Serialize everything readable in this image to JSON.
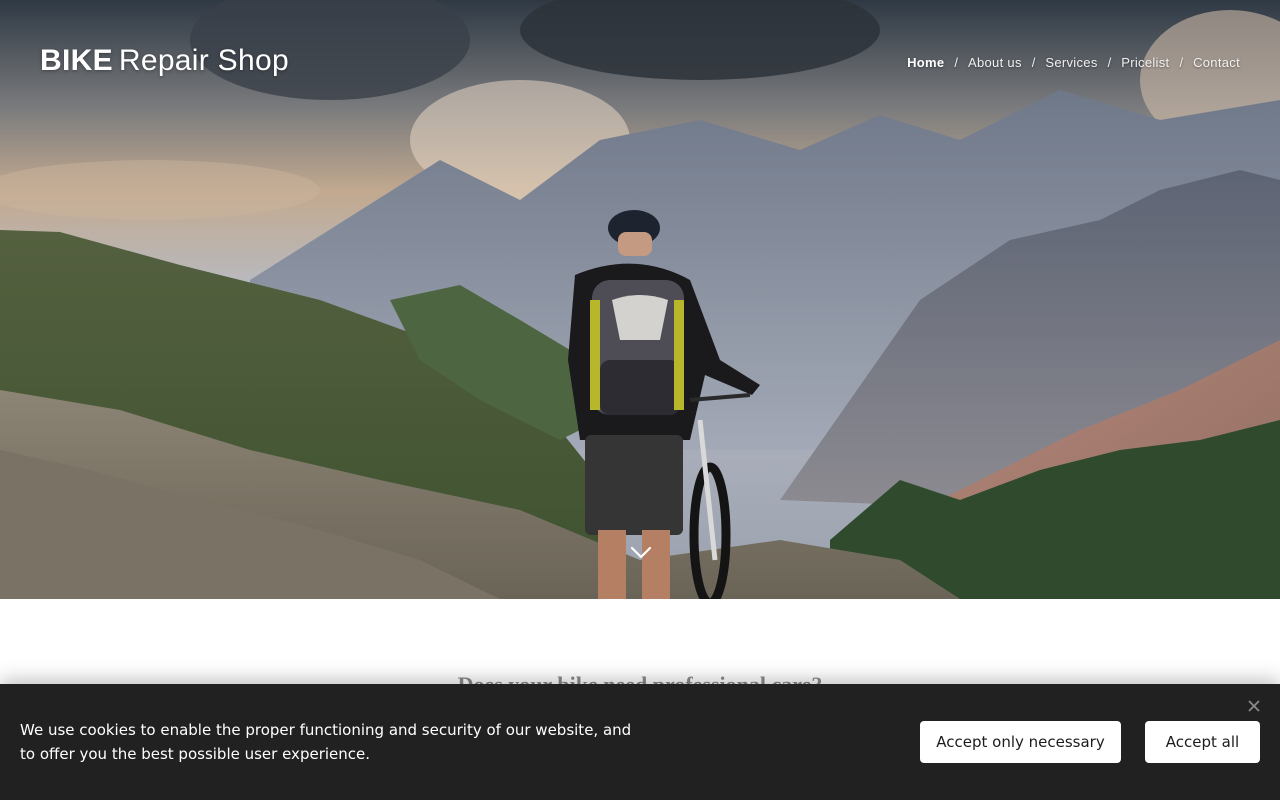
{
  "brand": {
    "strong": "BIKE",
    "light": "Repair Shop"
  },
  "nav": {
    "items": [
      {
        "label": "Home",
        "active": true
      },
      {
        "label": "About us",
        "active": false
      },
      {
        "label": "Services",
        "active": false
      },
      {
        "label": "Pricelist",
        "active": false
      },
      {
        "label": "Contact",
        "active": false
      }
    ],
    "separator": "/"
  },
  "hero": {
    "scroll_icon": "chevron-down-icon"
  },
  "section": {
    "heading": "Does your bike need professional care?"
  },
  "cookie_bar": {
    "text": "We use cookies to enable the proper functioning and security of our website, and to offer you the best possible user experience.",
    "accept_necessary": "Accept only necessary",
    "accept_all": "Accept all",
    "close_icon": "close-icon"
  },
  "colors": {
    "cookie_bg": "#212121",
    "button_bg": "#ffffff",
    "heading_text": "#8a8a8a"
  }
}
